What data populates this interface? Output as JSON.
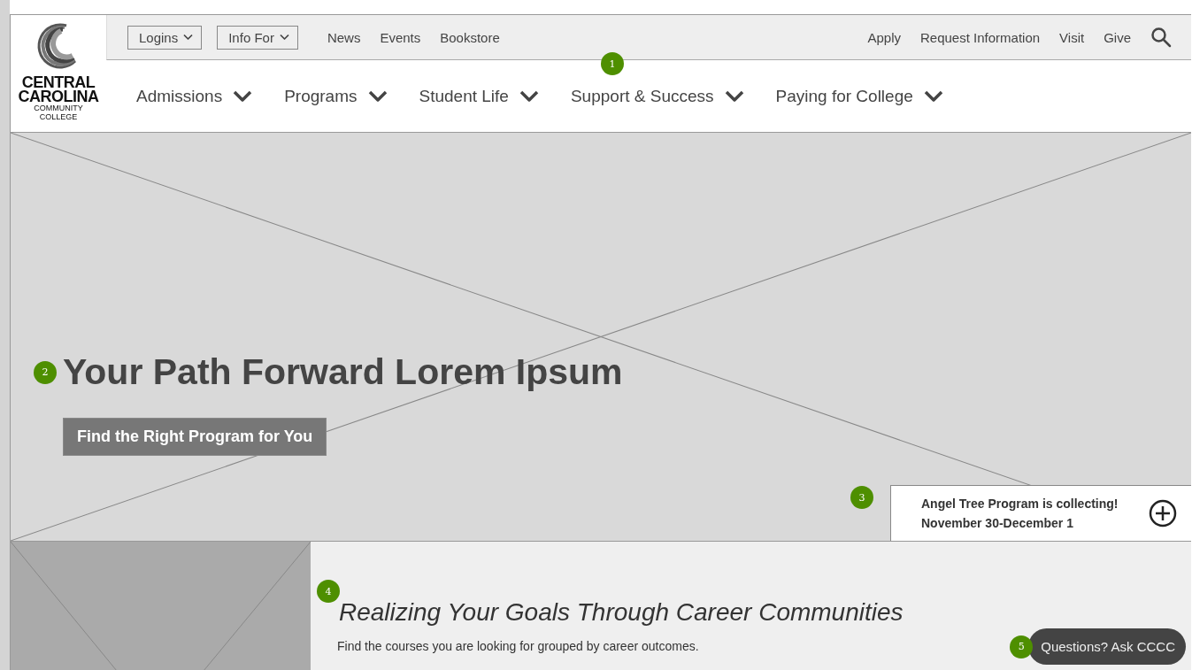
{
  "logo": {
    "lines": [
      "CENTRAL",
      "CAROLINA",
      "COMMUNITY",
      "COLLEGE"
    ]
  },
  "utility_nav": {
    "annotation": "1",
    "dropdowns": [
      "Logins",
      "Info For"
    ],
    "links": [
      "News",
      "Events",
      "Bookstore"
    ],
    "right_links": [
      "Apply",
      "Request Information",
      "Visit",
      "Give"
    ]
  },
  "main_nav": [
    "Admissions",
    "Programs",
    "Student Life",
    "Support & Success",
    "Paying for College"
  ],
  "hero": {
    "annotation": "2",
    "title": "Your Path Forward Lorem Ipsum",
    "button": "Find the Right Program for You"
  },
  "alert": {
    "annotation": "3",
    "lines": [
      "Angel Tree Program is collecting!",
      "November 30-December 1"
    ]
  },
  "section": {
    "annotation": "4",
    "title": "Realizing Your Goals Through Career Communities",
    "text": "Find the courses you are looking for grouped by career outcomes."
  },
  "chat": {
    "annotation": "5",
    "label": "Questions? Ask CCCC"
  }
}
